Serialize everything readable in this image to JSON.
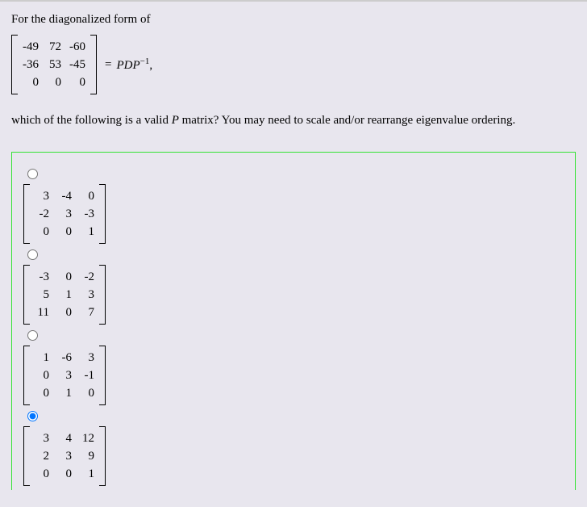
{
  "prompt": {
    "intro": "For the diagonalized form of",
    "question_matrix": [
      [
        "-49",
        "72",
        "-60"
      ],
      [
        "-36",
        "53",
        "-45"
      ],
      [
        "0",
        "0",
        "0"
      ]
    ],
    "equals": "=",
    "pdp_base": "PDP",
    "pdp_exp": "−1",
    "comma": ",",
    "tail": "which of the following is a valid",
    "tail_italic": "P",
    "tail_end": "matrix? You may need to scale and/or rearrange eigenvalue ordering."
  },
  "choices": [
    {
      "selected": false,
      "matrix": [
        [
          "3",
          "-4",
          "0"
        ],
        [
          "-2",
          "3",
          "-3"
        ],
        [
          "0",
          "0",
          "1"
        ]
      ]
    },
    {
      "selected": false,
      "matrix": [
        [
          "-3",
          "0",
          "-2"
        ],
        [
          "5",
          "1",
          "3"
        ],
        [
          "11",
          "0",
          "7"
        ]
      ]
    },
    {
      "selected": false,
      "matrix": [
        [
          "1",
          "-6",
          "3"
        ],
        [
          "0",
          "3",
          "-1"
        ],
        [
          "0",
          "1",
          "0"
        ]
      ]
    },
    {
      "selected": true,
      "matrix": [
        [
          "3",
          "4",
          "12"
        ],
        [
          "2",
          "3",
          "9"
        ],
        [
          "0",
          "0",
          "1"
        ]
      ]
    }
  ]
}
